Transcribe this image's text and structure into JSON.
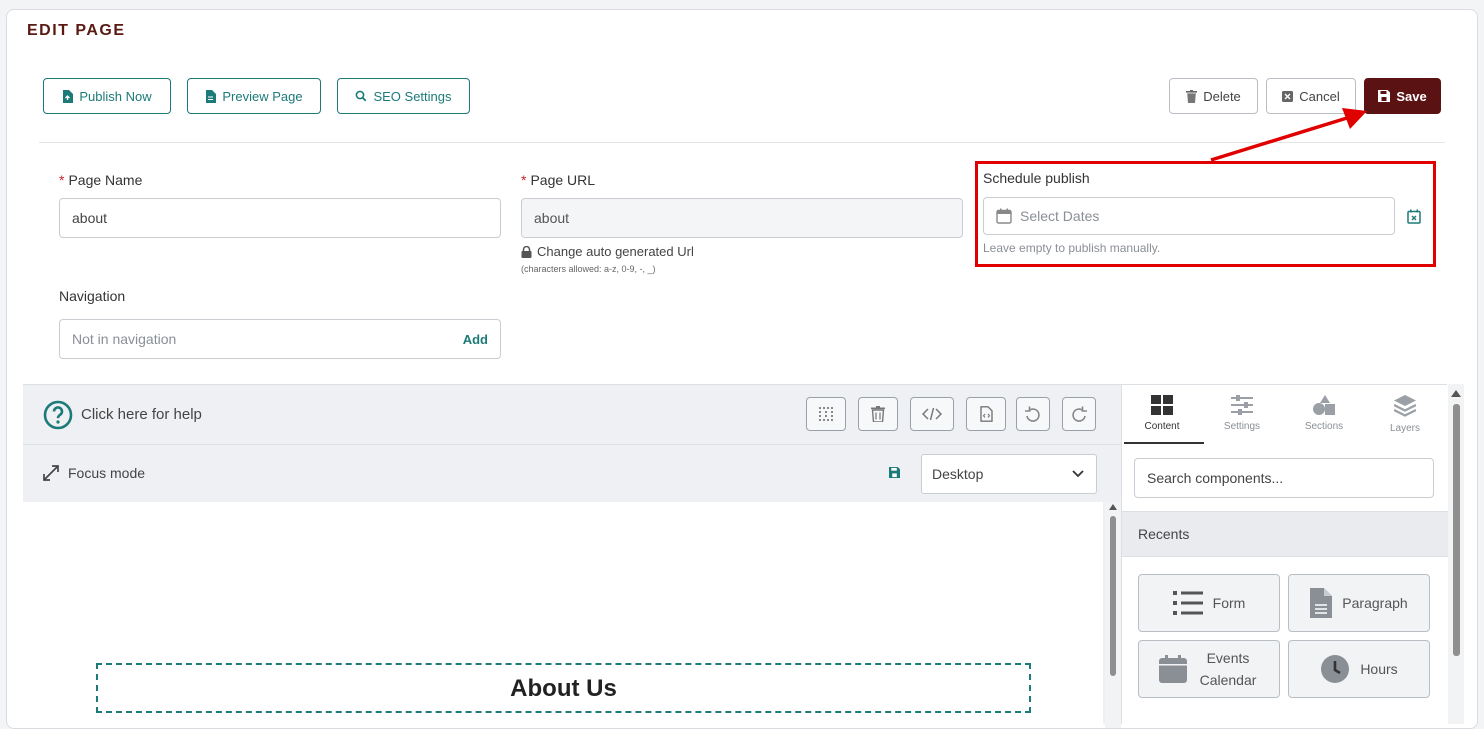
{
  "header": {
    "title": "EDIT PAGE"
  },
  "toolbar": {
    "publish_now": "Publish Now",
    "preview_page": "Preview Page",
    "seo_settings": "SEO Settings",
    "delete": "Delete",
    "cancel": "Cancel",
    "save": "Save"
  },
  "form": {
    "page_name_label": "Page Name",
    "page_name_value": "about",
    "page_url_label": "Page URL",
    "page_url_value": "about",
    "change_url_text": "Change auto generated Url",
    "chars_allowed": "(characters allowed: a-z, 0-9, -, _)",
    "schedule_label": "Schedule publish",
    "schedule_placeholder": "Select Dates",
    "schedule_hint": "Leave empty to publish manually.",
    "navigation_label": "Navigation",
    "navigation_placeholder": "Not in navigation",
    "navigation_add": "Add"
  },
  "editor": {
    "help_text": "Click here for help",
    "focus_mode": "Focus mode",
    "device_selected": "Desktop",
    "canvas_heading": "About Us"
  },
  "panel": {
    "tabs": [
      {
        "label": "Content",
        "icon": "grid-icon"
      },
      {
        "label": "Settings",
        "icon": "sliders-icon"
      },
      {
        "label": "Sections",
        "icon": "shapes-icon"
      },
      {
        "label": "Layers",
        "icon": "layers-icon"
      }
    ],
    "search_placeholder": "Search components...",
    "recents_label": "Recents",
    "components": [
      {
        "label": "Form",
        "icon": "list-icon"
      },
      {
        "label": "Paragraph",
        "icon": "document-icon"
      },
      {
        "label": "Events Calendar",
        "icon": "calendar-icon"
      },
      {
        "label": "Hours",
        "icon": "clock-icon"
      }
    ]
  },
  "colors": {
    "accent": "#1c7a78",
    "brand": "#5a1212",
    "highlight": "#e00000",
    "required": "#d01f2a"
  }
}
